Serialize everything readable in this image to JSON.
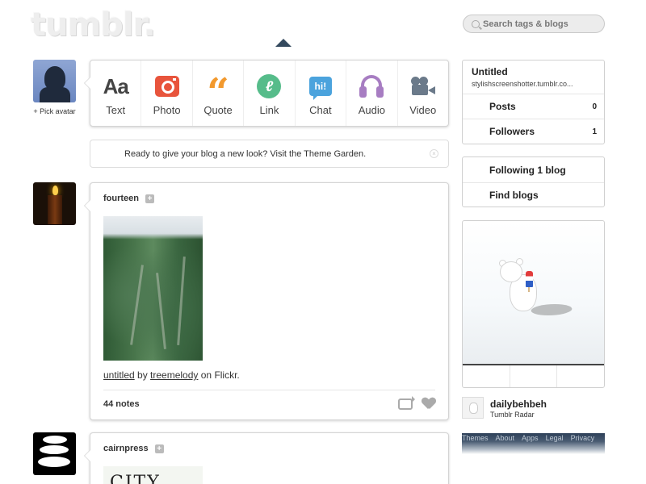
{
  "header": {
    "logo_text": "tumblr.",
    "search_placeholder": "Search tags & blogs"
  },
  "dashboard": {
    "pick_avatar_label": "+ Pick avatar",
    "post_types": [
      {
        "label": "Text",
        "icon": "text-icon",
        "glyph": "Aa"
      },
      {
        "label": "Photo",
        "icon": "camera-icon"
      },
      {
        "label": "Quote",
        "icon": "quote-icon",
        "glyph": "“"
      },
      {
        "label": "Link",
        "icon": "link-icon",
        "glyph": "ℓ"
      },
      {
        "label": "Chat",
        "icon": "chat-icon",
        "glyph": "hi!"
      },
      {
        "label": "Audio",
        "icon": "headphones-icon"
      },
      {
        "label": "Video",
        "icon": "video-camera-icon"
      }
    ],
    "notice": "Ready to give your blog a new look? Visit the Theme Garden.",
    "colors": {
      "photo": "#e8543c",
      "quote": "#f2992e",
      "link": "#56bc8a",
      "chat": "#4ba3dd",
      "audio": "#a77dc2",
      "video": "#6b7a8a",
      "header_caret": "#34495e"
    }
  },
  "posts": [
    {
      "author": "fourteen",
      "caption_link1": "untitled",
      "caption_by": " by ",
      "caption_link2": "treemelody",
      "caption_suffix": " on Flickr.",
      "notes": "44 notes"
    },
    {
      "author": "cairnpress",
      "preview_text": "CITY"
    }
  ],
  "sidebar": {
    "blog_name": "Untitled",
    "blog_url": "stylishscreenshotter.tumblr.co...",
    "stats": [
      {
        "label": "Posts",
        "count": "0"
      },
      {
        "label": "Followers",
        "count": "1"
      }
    ],
    "following_label": "Following 1 blog",
    "find_blogs_label": "Find blogs",
    "radar_user": "dailybehbeh",
    "radar_label": "Tumblr Radar",
    "footer_links": [
      "Themes",
      "About",
      "Apps",
      "Legal",
      "Privacy"
    ]
  }
}
